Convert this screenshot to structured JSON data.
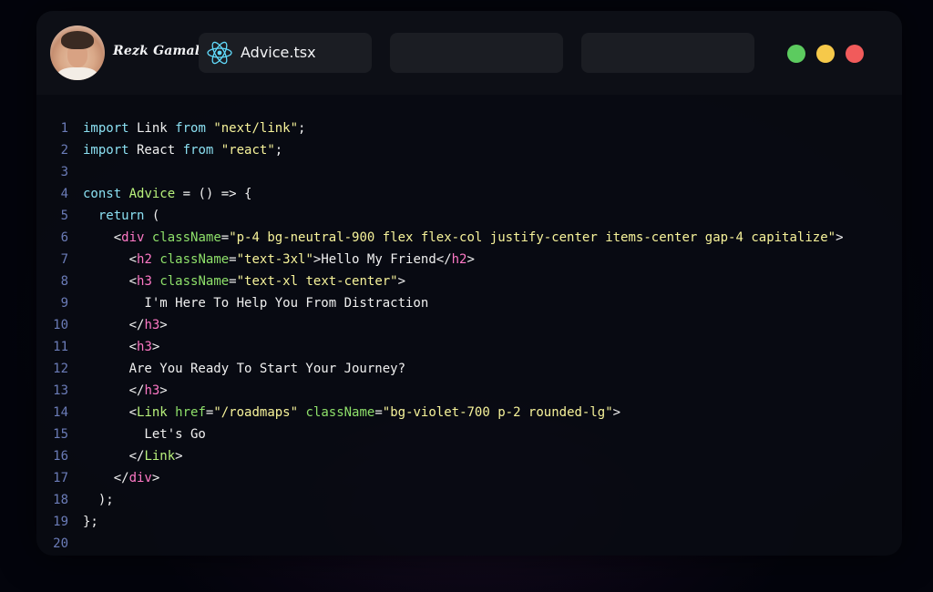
{
  "window": {
    "user_name": "Rezk Gamal",
    "tabs": [
      {
        "label": "Advice.tsx",
        "icon": "react-icon"
      },
      {
        "label": ""
      },
      {
        "label": ""
      }
    ],
    "controls": [
      {
        "name": "green-dot",
        "color": "#5ccb5f"
      },
      {
        "name": "yellow-dot",
        "color": "#f6c94a"
      },
      {
        "name": "red-dot",
        "color": "#f15b5b"
      }
    ]
  },
  "code": {
    "lines": [
      [
        [
          "kw",
          "import"
        ],
        [
          "plain",
          " Link "
        ],
        [
          "kw",
          "from"
        ],
        [
          "plain",
          " "
        ],
        [
          "str",
          "\"next/link\""
        ],
        [
          "plain",
          ";"
        ]
      ],
      [
        [
          "kw",
          "import"
        ],
        [
          "plain",
          " React "
        ],
        [
          "kw",
          "from"
        ],
        [
          "plain",
          " "
        ],
        [
          "str",
          "\"react\""
        ],
        [
          "plain",
          ";"
        ]
      ],
      [],
      [
        [
          "kw",
          "const"
        ],
        [
          "plain",
          " "
        ],
        [
          "fn",
          "Advice"
        ],
        [
          "plain",
          " = () => {"
        ]
      ],
      [
        [
          "plain",
          "  "
        ],
        [
          "kw",
          "return"
        ],
        [
          "plain",
          " ("
        ]
      ],
      [
        [
          "plain",
          "    <"
        ],
        [
          "tag",
          "div"
        ],
        [
          "plain",
          " "
        ],
        [
          "attr",
          "className"
        ],
        [
          "plain",
          "="
        ],
        [
          "str",
          "\"p-4 bg-neutral-900 flex flex-col justify-center items-center gap-4 capitalize\""
        ],
        [
          "plain",
          ">"
        ]
      ],
      [
        [
          "plain",
          "      <"
        ],
        [
          "tag",
          "h2"
        ],
        [
          "plain",
          " "
        ],
        [
          "attr",
          "className"
        ],
        [
          "plain",
          "="
        ],
        [
          "str",
          "\"text-3xl\""
        ],
        [
          "plain",
          ">Hello My Friend</"
        ],
        [
          "tag",
          "h2"
        ],
        [
          "plain",
          ">"
        ]
      ],
      [
        [
          "plain",
          "      <"
        ],
        [
          "tag",
          "h3"
        ],
        [
          "plain",
          " "
        ],
        [
          "attr",
          "className"
        ],
        [
          "plain",
          "="
        ],
        [
          "str",
          "\"text-xl text-center\""
        ],
        [
          "plain",
          ">"
        ]
      ],
      [
        [
          "plain",
          "        I'm Here To Help You From Distraction"
        ]
      ],
      [
        [
          "plain",
          "      </"
        ],
        [
          "tag",
          "h3"
        ],
        [
          "plain",
          ">"
        ]
      ],
      [
        [
          "plain",
          "      <"
        ],
        [
          "tag",
          "h3"
        ],
        [
          "plain",
          ">"
        ]
      ],
      [
        [
          "plain",
          "      Are You Ready To Start Your Journey?"
        ]
      ],
      [
        [
          "plain",
          "      </"
        ],
        [
          "tag",
          "h3"
        ],
        [
          "plain",
          ">"
        ]
      ],
      [
        [
          "plain",
          "      <"
        ],
        [
          "fn",
          "Link"
        ],
        [
          "plain",
          " "
        ],
        [
          "attr",
          "href"
        ],
        [
          "plain",
          "="
        ],
        [
          "str",
          "\"/roadmaps\""
        ],
        [
          "plain",
          " "
        ],
        [
          "attr",
          "className"
        ],
        [
          "plain",
          "="
        ],
        [
          "str",
          "\"bg-violet-700 p-2 rounded-lg\""
        ],
        [
          "plain",
          ">"
        ]
      ],
      [
        [
          "plain",
          "        Let's Go"
        ]
      ],
      [
        [
          "plain",
          "      </"
        ],
        [
          "fn",
          "Link"
        ],
        [
          "plain",
          ">"
        ]
      ],
      [
        [
          "plain",
          "    </"
        ],
        [
          "tag",
          "div"
        ],
        [
          "plain",
          ">"
        ]
      ],
      [
        [
          "plain",
          "  );"
        ]
      ],
      [
        [
          "plain",
          "};"
        ]
      ],
      []
    ]
  }
}
